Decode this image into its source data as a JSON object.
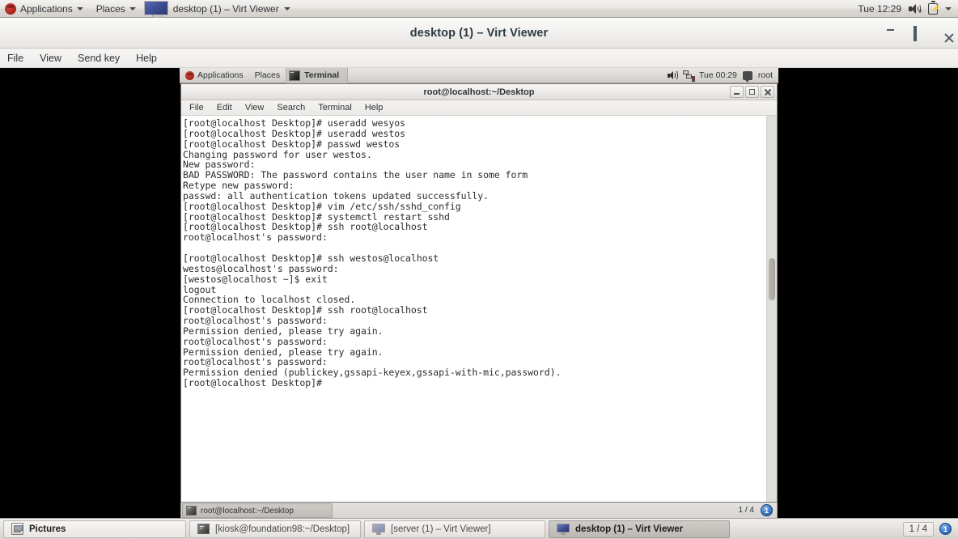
{
  "host_panel": {
    "applications_label": "Applications",
    "places_label": "Places",
    "active_window_label": "desktop (1) – Virt Viewer",
    "clock": "Tue 12:29",
    "logo_icon": "redhat-logo-icon",
    "volume_icon": "volume-muted-icon",
    "battery_icon": "battery-charging-icon",
    "caret_icon": "chevron-down-icon"
  },
  "virt_viewer": {
    "title": "desktop (1) – Virt Viewer",
    "menu": [
      "File",
      "View",
      "Send key",
      "Help"
    ],
    "window_buttons": {
      "minimize": "minimize-icon",
      "maximize": "maximize-icon",
      "close": "close-icon"
    }
  },
  "guest_panel": {
    "applications_label": "Applications",
    "places_label": "Places",
    "taskbar_window": "Terminal",
    "clock": "Tue 00:29",
    "user": "root",
    "volume_icon": "volume-icon",
    "network_icon": "network-disconnected-icon",
    "user_icon": "user-icon"
  },
  "terminal": {
    "title": "root@localhost:~/Desktop",
    "menu": [
      "File",
      "Edit",
      "View",
      "Search",
      "Terminal",
      "Help"
    ],
    "content": "[root@localhost Desktop]# useradd wesyos\n[root@localhost Desktop]# useradd westos\n[root@localhost Desktop]# passwd westos\nChanging password for user westos.\nNew password:\nBAD PASSWORD: The password contains the user name in some form\nRetype new password:\npasswd: all authentication tokens updated successfully.\n[root@localhost Desktop]# vim /etc/ssh/sshd_config\n[root@localhost Desktop]# systemctl restart sshd\n[root@localhost Desktop]# ssh root@localhost\nroot@localhost's password:\n\n[root@localhost Desktop]# ssh westos@localhost\nwestos@localhost's password:\n[westos@localhost ~]$ exit\nlogout\nConnection to localhost closed.\n[root@localhost Desktop]# ssh root@localhost\nroot@localhost's password:\nPermission denied, please try again.\nroot@localhost's password:\nPermission denied, please try again.\nroot@localhost's password:\nPermission denied (publickey,gssapi-keyex,gssapi-with-mic,password).\n[root@localhost Desktop]#",
    "window_buttons": {
      "minimize": "minimize-icon",
      "maximize": "maximize-icon",
      "close": "close-icon"
    }
  },
  "guest_statusbar": {
    "task_label": "root@localhost:~/Desktop",
    "workspace": "1 / 4",
    "pager_badge": "1"
  },
  "host_taskbar": {
    "items": [
      {
        "label": "Pictures",
        "icon": "pictures-icon",
        "active": false
      },
      {
        "label": "[kiosk@foundation98:~/Desktop]",
        "icon": "terminal-icon",
        "active": false
      },
      {
        "label": "[server (1) – Virt Viewer]",
        "icon": "monitor-icon",
        "active": false
      },
      {
        "label": "desktop (1) – Virt Viewer",
        "icon": "monitor-icon",
        "active": true
      }
    ],
    "workspace": "1 / 4",
    "pager_badge": "1"
  },
  "colors": {
    "panel_bg": "#e4e1de",
    "terminal_bg": "#ffffff",
    "terminal_fg": "#2b2b2b",
    "accent_blue": "#3a7ac8",
    "canvas_black": "#000000"
  }
}
